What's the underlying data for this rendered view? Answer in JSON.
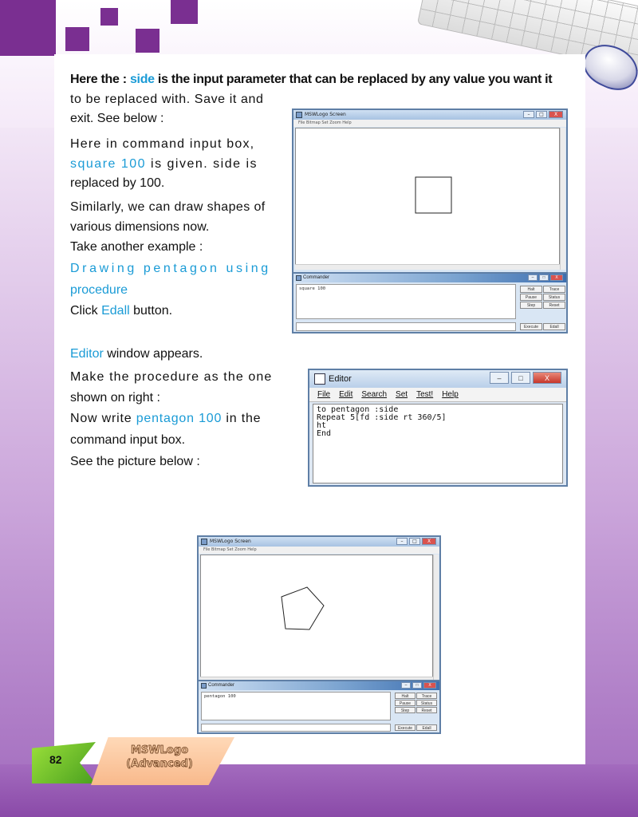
{
  "page_number": "82",
  "footer_title_line1": "MSWLogo",
  "footer_title_line2": "(Advanced)",
  "para1": {
    "a": "Here the : ",
    "hl": "side",
    "b": " is the input parameter that can be replaced by any value you want it",
    "line2": "to be replaced with. Save it and",
    "line3": "exit. See below :"
  },
  "para2": {
    "a": "Here in command input box,",
    "hl": "square 100",
    "b": " is given. side is",
    "line3": "replaced by 100."
  },
  "para3": {
    "line1": "Similarly, we can draw shapes of",
    "line2": "various dimensions now.",
    "line3": "Take another example :"
  },
  "heading": {
    "line1": "Drawing pentagon using",
    "line2": "procedure"
  },
  "click_line": {
    "a": "Click ",
    "hl": "Edall",
    "b": " button."
  },
  "editor_line": {
    "hl": "Editor",
    "b": " window appears."
  },
  "para4": {
    "line1": "Make the procedure as the one",
    "line2": "shown on right :",
    "line3a": "Now write ",
    "line3hl": "pentagon 100",
    "line3b": " in the",
    "line4": "command input box.",
    "line5": "See the picture below :"
  },
  "screen1": {
    "title": "MSWLogo Screen",
    "menu": "File   Bitmap   Set   Zoom   Help",
    "command_history": "square 100",
    "commander_title": "Commander",
    "buttons": [
      "Halt",
      "Trace",
      "Pause",
      "Status",
      "Step",
      "Reset",
      "Execute",
      "Edall"
    ]
  },
  "editor": {
    "title": "Editor",
    "menu": [
      "File",
      "Edit",
      "Search",
      "Set",
      "Test!",
      "Help"
    ],
    "code": "to pentagon :side\nRepeat 5[fd :side rt 360/5]\nht\nEnd"
  },
  "screen2": {
    "title": "MSWLogo Screen",
    "menu": "File   Bitmap   Set   Zoom   Help",
    "command_history": "pentagon 100",
    "commander_title": "Commander",
    "buttons": [
      "Halt",
      "Trace",
      "Pause",
      "Status",
      "Step",
      "Reset",
      "Execute",
      "Edall"
    ]
  },
  "window_controls": {
    "min": "–",
    "max": "□",
    "close": "X"
  }
}
